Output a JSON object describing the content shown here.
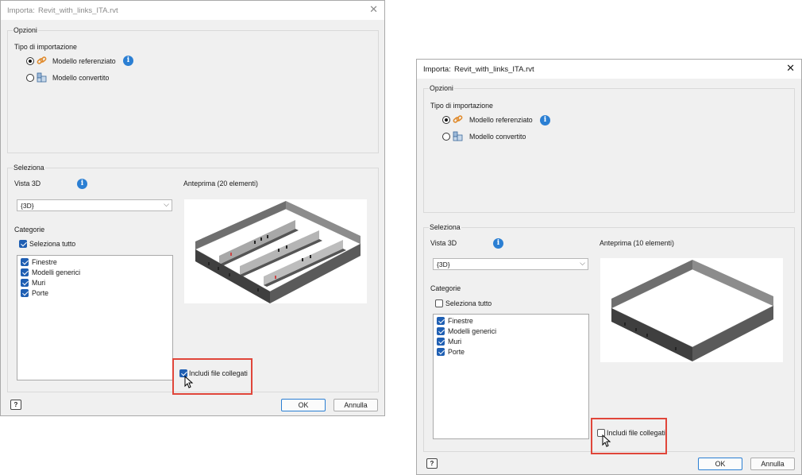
{
  "left_dialog": {
    "title_prefix": "Importa:",
    "title_file": "Revit_with_links_ITA.rvt",
    "options": {
      "group_label": "Opzioni",
      "import_type_label": "Tipo di importazione",
      "radio_referenced": "Modello referenziato",
      "radio_converted": "Modello convertito",
      "selected": "referenced"
    },
    "select_group": {
      "group_label": "Seleziona",
      "view3d_label": "Vista 3D",
      "view3d_value": "{3D}",
      "preview_label": "Anteprima (20 elementi)",
      "categories_label": "Categorie",
      "select_all_label": "Seleziona tutto",
      "select_all_checked": true,
      "categories": [
        {
          "label": "Finestre",
          "checked": true
        },
        {
          "label": "Modelli generici",
          "checked": true
        },
        {
          "label": "Muri",
          "checked": true
        },
        {
          "label": "Porte",
          "checked": true
        }
      ]
    },
    "include_linked_label": "Includi file collegati",
    "include_linked_checked": true,
    "ok_label": "OK",
    "cancel_label": "Annulla",
    "help_icon": "help-icon"
  },
  "right_dialog": {
    "title_prefix": "Importa:",
    "title_file": "Revit_with_links_ITA.rvt",
    "options": {
      "group_label": "Opzioni",
      "import_type_label": "Tipo di importazione",
      "radio_referenced": "Modello referenziato",
      "radio_converted": "Modello convertito",
      "selected": "referenced"
    },
    "select_group": {
      "group_label": "Seleziona",
      "view3d_label": "Vista 3D",
      "view3d_value": "{3D}",
      "preview_label": "Anteprima (10 elementi)",
      "categories_label": "Categorie",
      "select_all_label": "Seleziona tutto",
      "select_all_checked": false,
      "categories": [
        {
          "label": "Finestre",
          "checked": true
        },
        {
          "label": "Modelli generici",
          "checked": true
        },
        {
          "label": "Muri",
          "checked": true
        },
        {
          "label": "Porte",
          "checked": true
        }
      ]
    },
    "include_linked_label": "Includi file collegati",
    "include_linked_checked": false,
    "ok_label": "OK",
    "cancel_label": "Annulla",
    "help_icon": "help-icon"
  },
  "colors": {
    "highlight": "#e0463a",
    "accent": "#1f5fb3",
    "info": "#2b7fd3"
  }
}
